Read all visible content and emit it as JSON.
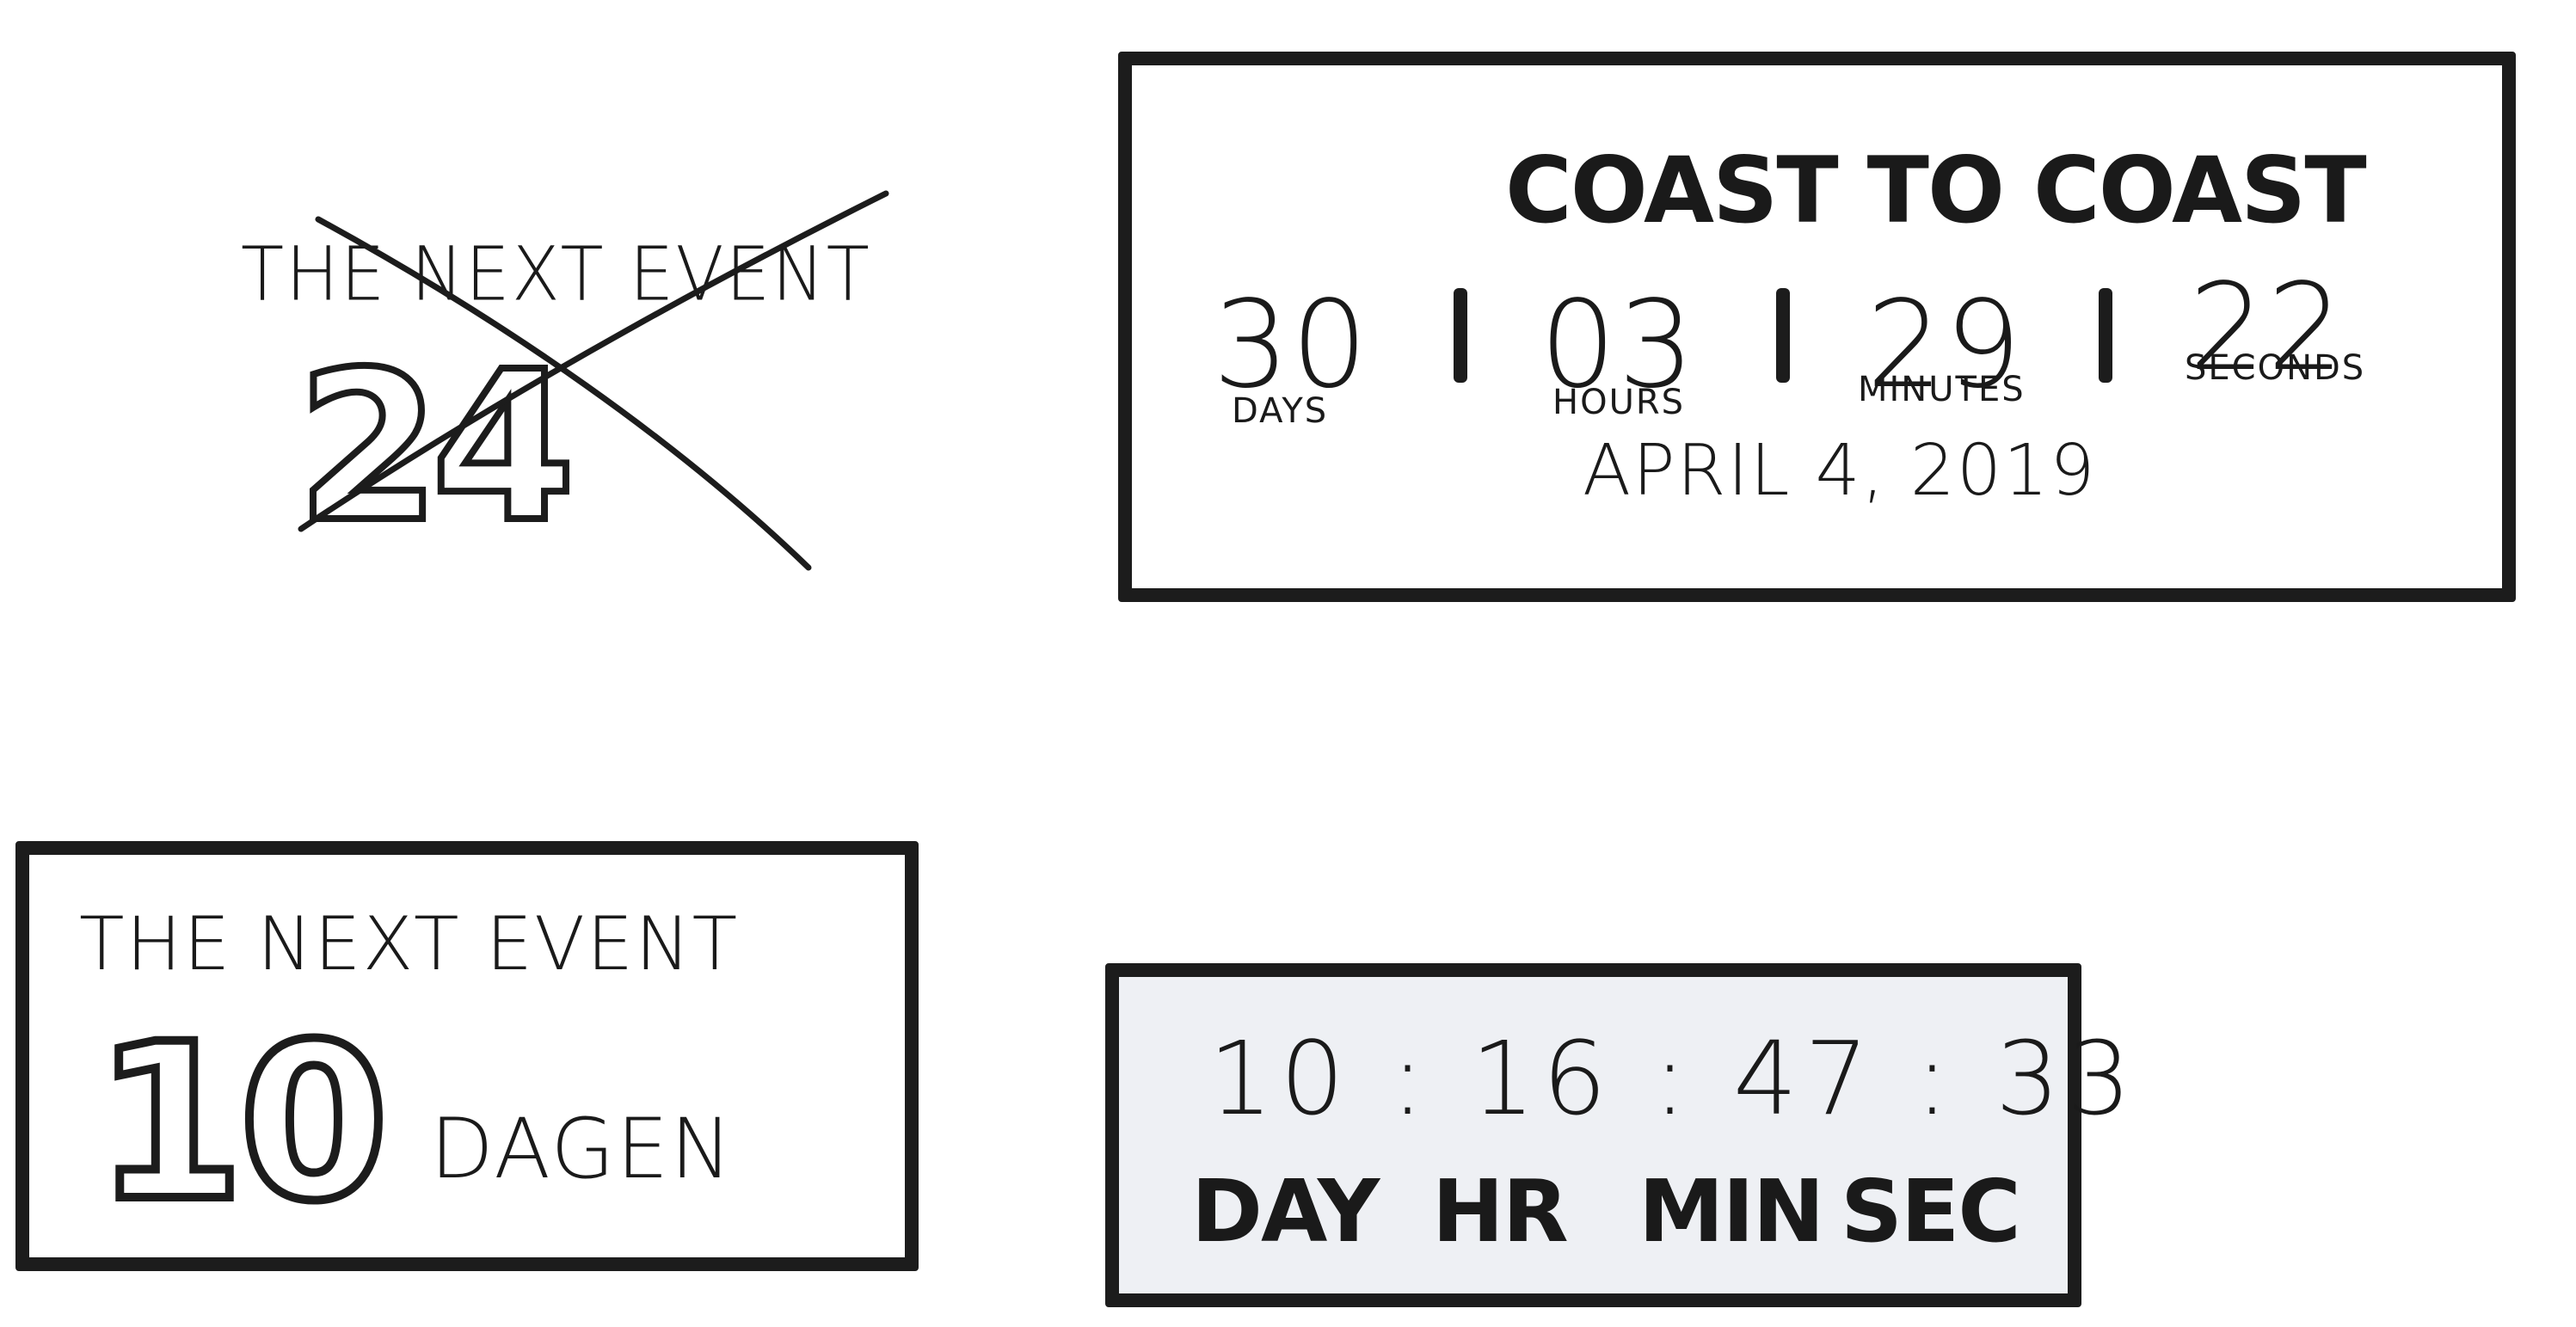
{
  "sketch_crossed": {
    "title": "THE NEXT EVENT",
    "number": "24"
  },
  "sketch_coast": {
    "title": "COAST TO COAST",
    "units": [
      {
        "value": "30",
        "label": "DAYS"
      },
      {
        "value": "03",
        "label": "HOURS"
      },
      {
        "value": "29",
        "label": "MINUTES"
      },
      {
        "value": "22",
        "label": "SECONDS"
      }
    ],
    "date": "APRIL 4, 2019"
  },
  "sketch_dagen": {
    "title": "THE NEXT EVENT",
    "number": "10",
    "unit": "DAGEN"
  },
  "sketch_timer": {
    "time": "10 : 16 : 47 : 33",
    "labels": [
      "DAY",
      "HR",
      "MIN",
      "SEC"
    ]
  },
  "colors": {
    "ink": "#1c1c1c",
    "paper": "#ffffff",
    "timer_fill": "#eef0f4"
  }
}
